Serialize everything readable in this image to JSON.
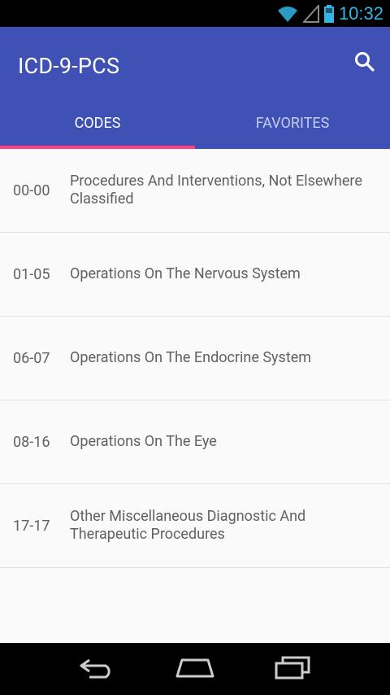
{
  "status_bar": {
    "time": "10:32"
  },
  "app": {
    "title": "ICD-9-PCS"
  },
  "tabs": [
    {
      "label": "CODES",
      "active": true
    },
    {
      "label": "FAVORITES",
      "active": false
    }
  ],
  "items": [
    {
      "code": "00-00",
      "description": "Procedures And Interventions, Not Elsewhere Classified"
    },
    {
      "code": "01-05",
      "description": "Operations On The Nervous System"
    },
    {
      "code": "06-07",
      "description": "Operations On The Endocrine System"
    },
    {
      "code": "08-16",
      "description": "Operations On The Eye"
    },
    {
      "code": "17-17",
      "description": "Other Miscellaneous Diagnostic And Therapeutic Procedures"
    }
  ],
  "colors": {
    "primary": "#3f51b5",
    "accent": "#ff4081",
    "status": "#33b5e5"
  },
  "icons": [
    "wifi-icon",
    "signal-icon",
    "battery-icon",
    "search-icon",
    "back-icon",
    "home-icon",
    "recents-icon"
  ]
}
